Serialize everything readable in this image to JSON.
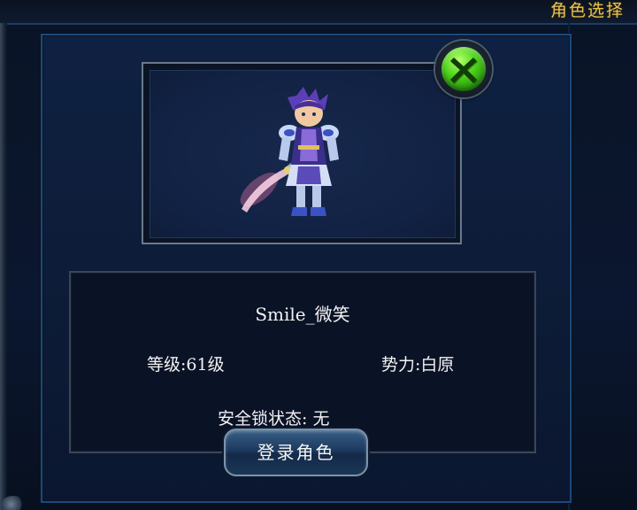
{
  "header": {
    "title": "角色选择"
  },
  "character": {
    "name": "Smile_微笑",
    "level": "等级:61级",
    "faction": "势力:白原",
    "lock_status": "安全锁状态: 无"
  },
  "actions": {
    "login_label": "登录角色",
    "close_icon": "close-x-icon"
  },
  "colors": {
    "title": "#e6c352",
    "close_green": "#4fd51d",
    "panel_border": "#1c4a7a"
  }
}
